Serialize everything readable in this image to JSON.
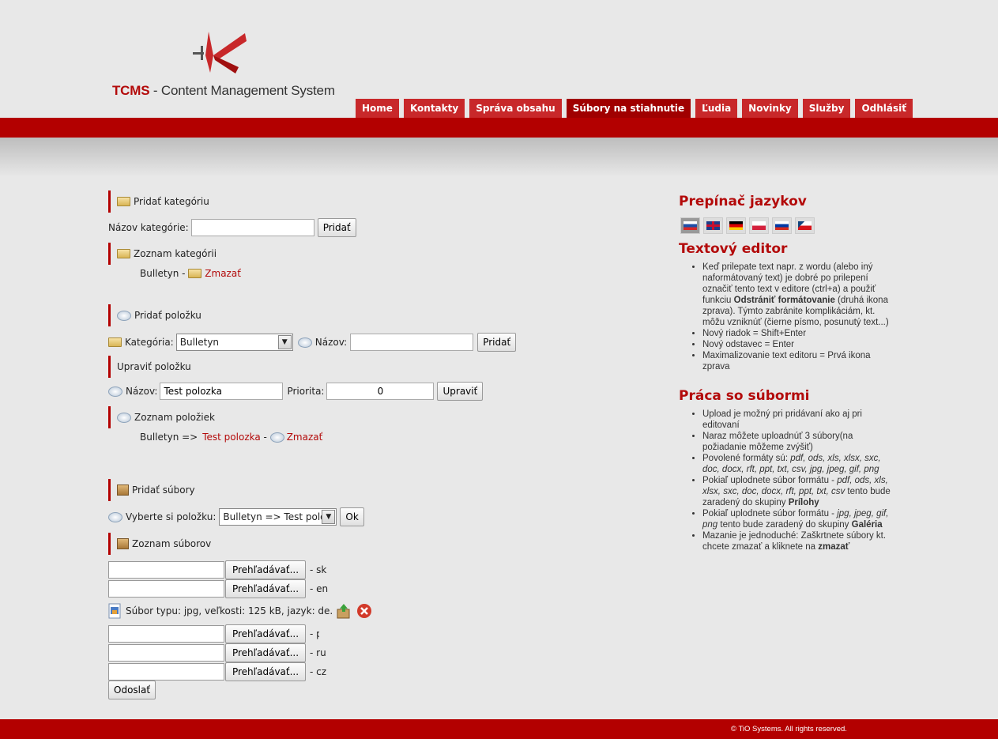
{
  "header": {
    "logo_brand": "TCMS",
    "logo_rest": " - Content Management System"
  },
  "nav": [
    {
      "label": "Home"
    },
    {
      "label": "Kontakty"
    },
    {
      "label": "Správa obsahu"
    },
    {
      "label": "Súbory na stiahnutie"
    },
    {
      "label": "Ľudia"
    },
    {
      "label": "Novinky"
    },
    {
      "label": "Služby"
    },
    {
      "label": "Odhlásiť"
    }
  ],
  "add_category": {
    "title": "Pridať kategóriu",
    "name_label": "Názov kategórie:",
    "name_value": "",
    "submit": "Pridať"
  },
  "category_list": {
    "title": "Zoznam kategórii",
    "item": "Bulletyn",
    "separator": " - ",
    "delete": "Zmazať"
  },
  "add_item": {
    "title": "Pridať položku",
    "category_label": "Kategória:",
    "category_selected": "Bulletyn",
    "name_label": "Názov:",
    "name_value": "",
    "submit": "Pridať"
  },
  "edit_item": {
    "title": "Upraviť položku",
    "name_label": "Názov:",
    "name_value": "Test polozka",
    "priority_label": "Priorita:",
    "priority_value": "0",
    "submit": "Upraviť"
  },
  "item_list": {
    "title": "Zoznam položiek",
    "prefix": "Bulletyn =>",
    "item": "Test polozka",
    "separator": " - ",
    "delete": "Zmazať"
  },
  "add_files": {
    "title": "Pridať súbory",
    "choose_label": "Vyberte si položku:",
    "choose_selected": "Bulletyn => Test polozka",
    "ok": "Ok"
  },
  "file_list": {
    "title": "Zoznam súborov",
    "browse": "Prehľadávať...",
    "rows_top": [
      {
        "lang": "- sk"
      },
      {
        "lang": "- en"
      }
    ],
    "existing": "Súbor typu: jpg, veľkosti: 125 kB, jazyk: de.",
    "rows_bottom": [
      {
        "lang": "- pl"
      },
      {
        "lang": "- ru"
      },
      {
        "lang": "- cz"
      }
    ],
    "submit": "Odoslať"
  },
  "sidebar": {
    "lang_title": "Prepínač jazykov",
    "editor_title": "Textový editor",
    "editor_items": [
      "Keď prilepate text napr. z wordu (alebo iný naformátovaný text) je dobré po prilepení označiť tento text v editore (ctrl+a) a použiť funkciu",
      "Odstrániť formátovanie",
      "(druhá ikona zprava). Týmto zabránite komplikáciám, kt. môžu vzniknúť (čierne písmo, posunutý text...)",
      "Nový riadok = Shift+Enter",
      "Nový odstavec = Enter",
      "Maximalizovanie text editoru = Prvá ikona zprava"
    ],
    "files_title": "Práca so súbormi",
    "files_items": {
      "upload": "Upload je možný pri pridávaní ako aj pri editovaní",
      "count": "Naraz môžete uploadnúť 3 súbory(na požiadanie môžeme zvýšiť)",
      "formats_label": "Povolené formáty sú:",
      "formats": "pdf, ods, xls, xlsx, sxc, doc, docx, rft, ppt, txt, csv, jpg, jpeg, gif, png",
      "att_pre": "Pokiaľ uplodnete súbor formátu -",
      "att_formats": "pdf, ods, xls, xlsx, sxc, doc, docx, rft, ppt, txt, csv",
      "att_post": "tento bude zaradený do skupiny",
      "att_group": "Prílohy",
      "gal_pre": "Pokiaľ uplodnete súbor formátu -",
      "gal_formats": "jpg, jpeg, gif, png",
      "gal_post": "tento bude zaradený do skupiny",
      "gal_group": "Galéria",
      "del_pre": "Mazanie je jednoduché: Zaškrtnete súbory kt. chcete zmazať a kliknete na",
      "del_word": "zmazať"
    }
  },
  "footer": {
    "copyright": "© TiO Systems. All rights reserved."
  }
}
